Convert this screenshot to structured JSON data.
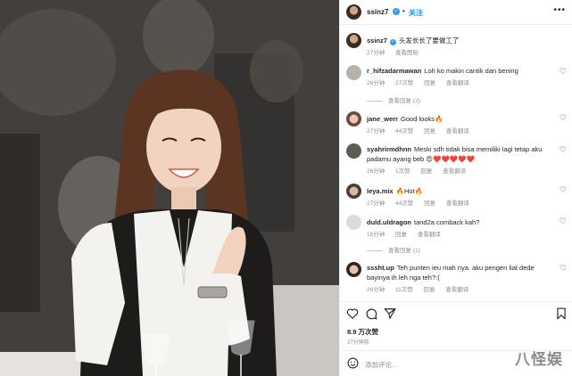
{
  "post": {
    "username": "ssinz7",
    "follow_label": "关注",
    "more_icon": "more-options-icon",
    "caption": "头发长长了要做工了",
    "caption_time": "27分钟",
    "caption_translate": "查看图贴"
  },
  "comments": [
    {
      "username": "r_hifzadarmawan",
      "text": "Loh ko makin cantik dan bening",
      "time": "26分钟",
      "likes": "27次赞",
      "reply": "回复",
      "translate": "查看翻译",
      "replies": "查看回复 (2)"
    },
    {
      "username": "jane_werr",
      "text": "Good looks🔥",
      "time": "27分钟",
      "likes": "44次赞",
      "reply": "回复",
      "translate": "查看翻译"
    },
    {
      "username": "syahrirmdhnn",
      "text": "Meski sdh tidak bisa memiliki lagi tetap aku padamu ayang beb 😍❤️❤️❤️❤️❤️",
      "time": "26分钟",
      "likes": "1次赞",
      "reply": "回复",
      "translate": "查看翻译"
    },
    {
      "username": "leya.mix",
      "text": "🔥Hot🔥",
      "time": "27分钟",
      "likes": "44次赞",
      "reply": "回复",
      "translate": "查看翻译"
    },
    {
      "username": "duld.uldragon",
      "text": "tand2a comback kah?",
      "time": "16分钟",
      "reply": "回复",
      "translate": "查看翻译",
      "replies": "查看回复 (1)"
    },
    {
      "username": "sssht.up",
      "text": "Teh punten ieu mah nya. aku pengen liat dede bayinya ih leh nga teh?:(",
      "time": "26分钟",
      "likes": "11次赞",
      "reply": "回复",
      "translate": "查看翻译"
    }
  ],
  "actions": {
    "likes": "8.9 万次赞",
    "post_time": "27分钟前"
  },
  "add_comment": {
    "placeholder": "添加评论..."
  },
  "watermark": "八怪娱",
  "colors": {
    "accent": "#0095f6",
    "verified": "#3897f0",
    "muted": "#8e8e8e"
  }
}
